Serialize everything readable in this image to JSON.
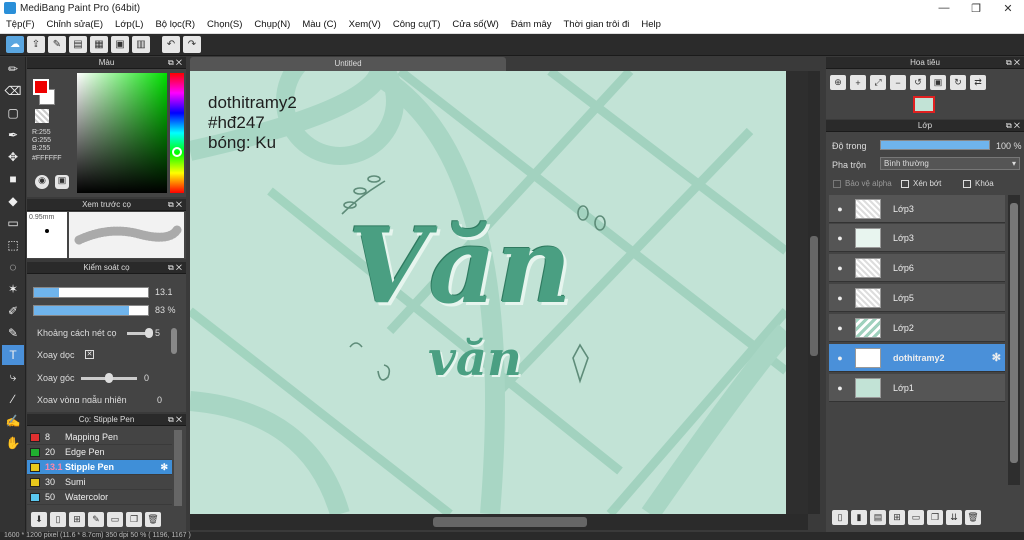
{
  "window": {
    "title": "MediBang Paint Pro (64bit)",
    "controls": [
      "—",
      "❐",
      "✕"
    ]
  },
  "menu": [
    "Tệp(F)",
    "Chỉnh sửa(E)",
    "Lớp(L)",
    "Bộ lọc(R)",
    "Chọn(S)",
    "Chụp(N)",
    "Màu (C)",
    "Xem(V)",
    "Công cụ(T)",
    "Cửa số(W)",
    "Đám mây",
    "Thời gian trôi đi",
    "Help"
  ],
  "color_panel": {
    "title": "Màu",
    "r": "R:255",
    "g": "G:255",
    "b": "B:255",
    "hex": "#FFFFFF"
  },
  "brush_preview": {
    "title": "Xem trước cọ",
    "size": "0.95mm"
  },
  "brush_control": {
    "title": "Kiểm soát cọ",
    "size_value": "13.1",
    "size_fraction": 0.22,
    "opacity_value": "83 %",
    "opacity_fraction": 0.83,
    "spacing_label": "Khoảng cách nét cọ",
    "spacing_value": "5",
    "flip_label": "Xoay dọc",
    "angle_label": "Xoay góc",
    "angle_value": "0",
    "random_label": "Xoay vòng ngẫu nhiên",
    "random_value": "0"
  },
  "brush_list": {
    "title": "Cọ: Stipple Pen",
    "items": [
      {
        "num": "8",
        "name": "Mapping Pen",
        "color": "#e03030"
      },
      {
        "num": "20",
        "name": "Edge Pen",
        "color": "#20b030"
      },
      {
        "num": "13.1",
        "name": "Stipple Pen",
        "color": "#e8c81c",
        "selected": true
      },
      {
        "num": "30",
        "name": "Sumi",
        "color": "#e8c81c"
      },
      {
        "num": "50",
        "name": "Watercolor",
        "color": "#5ac8f0"
      }
    ]
  },
  "document": {
    "tab": "Untitled"
  },
  "canvas_text": {
    "line1": "dothitramy2",
    "line2": "#hđ247",
    "line3": "bóng: Ku",
    "main": "Văn",
    "sub": "văn"
  },
  "navigator": {
    "title": "Hoa tiêu"
  },
  "layer_panel": {
    "title": "Lớp",
    "opacity_label": "Độ trong",
    "opacity_value": "100 %",
    "opacity_fraction": 1.0,
    "blend_label": "Pha trộn",
    "blend_value": "Bình thường",
    "protect_alpha": "Bảo vệ alpha",
    "clipping": "Xén bớt",
    "lock": "Khóa",
    "layers": [
      {
        "name": "Lớp3",
        "selected": false
      },
      {
        "name": "Lớp3",
        "selected": false
      },
      {
        "name": "Lớp6",
        "selected": false
      },
      {
        "name": "Lớp5",
        "selected": false
      },
      {
        "name": "Lớp2",
        "selected": false
      },
      {
        "name": "dothitramy2",
        "selected": true
      },
      {
        "name": "Lớp1",
        "selected": false
      }
    ]
  },
  "status": "1600 * 1200 pixel   (11.6 * 8.7cm)   350 dpi   50 %   ( 1196, 1167 )"
}
